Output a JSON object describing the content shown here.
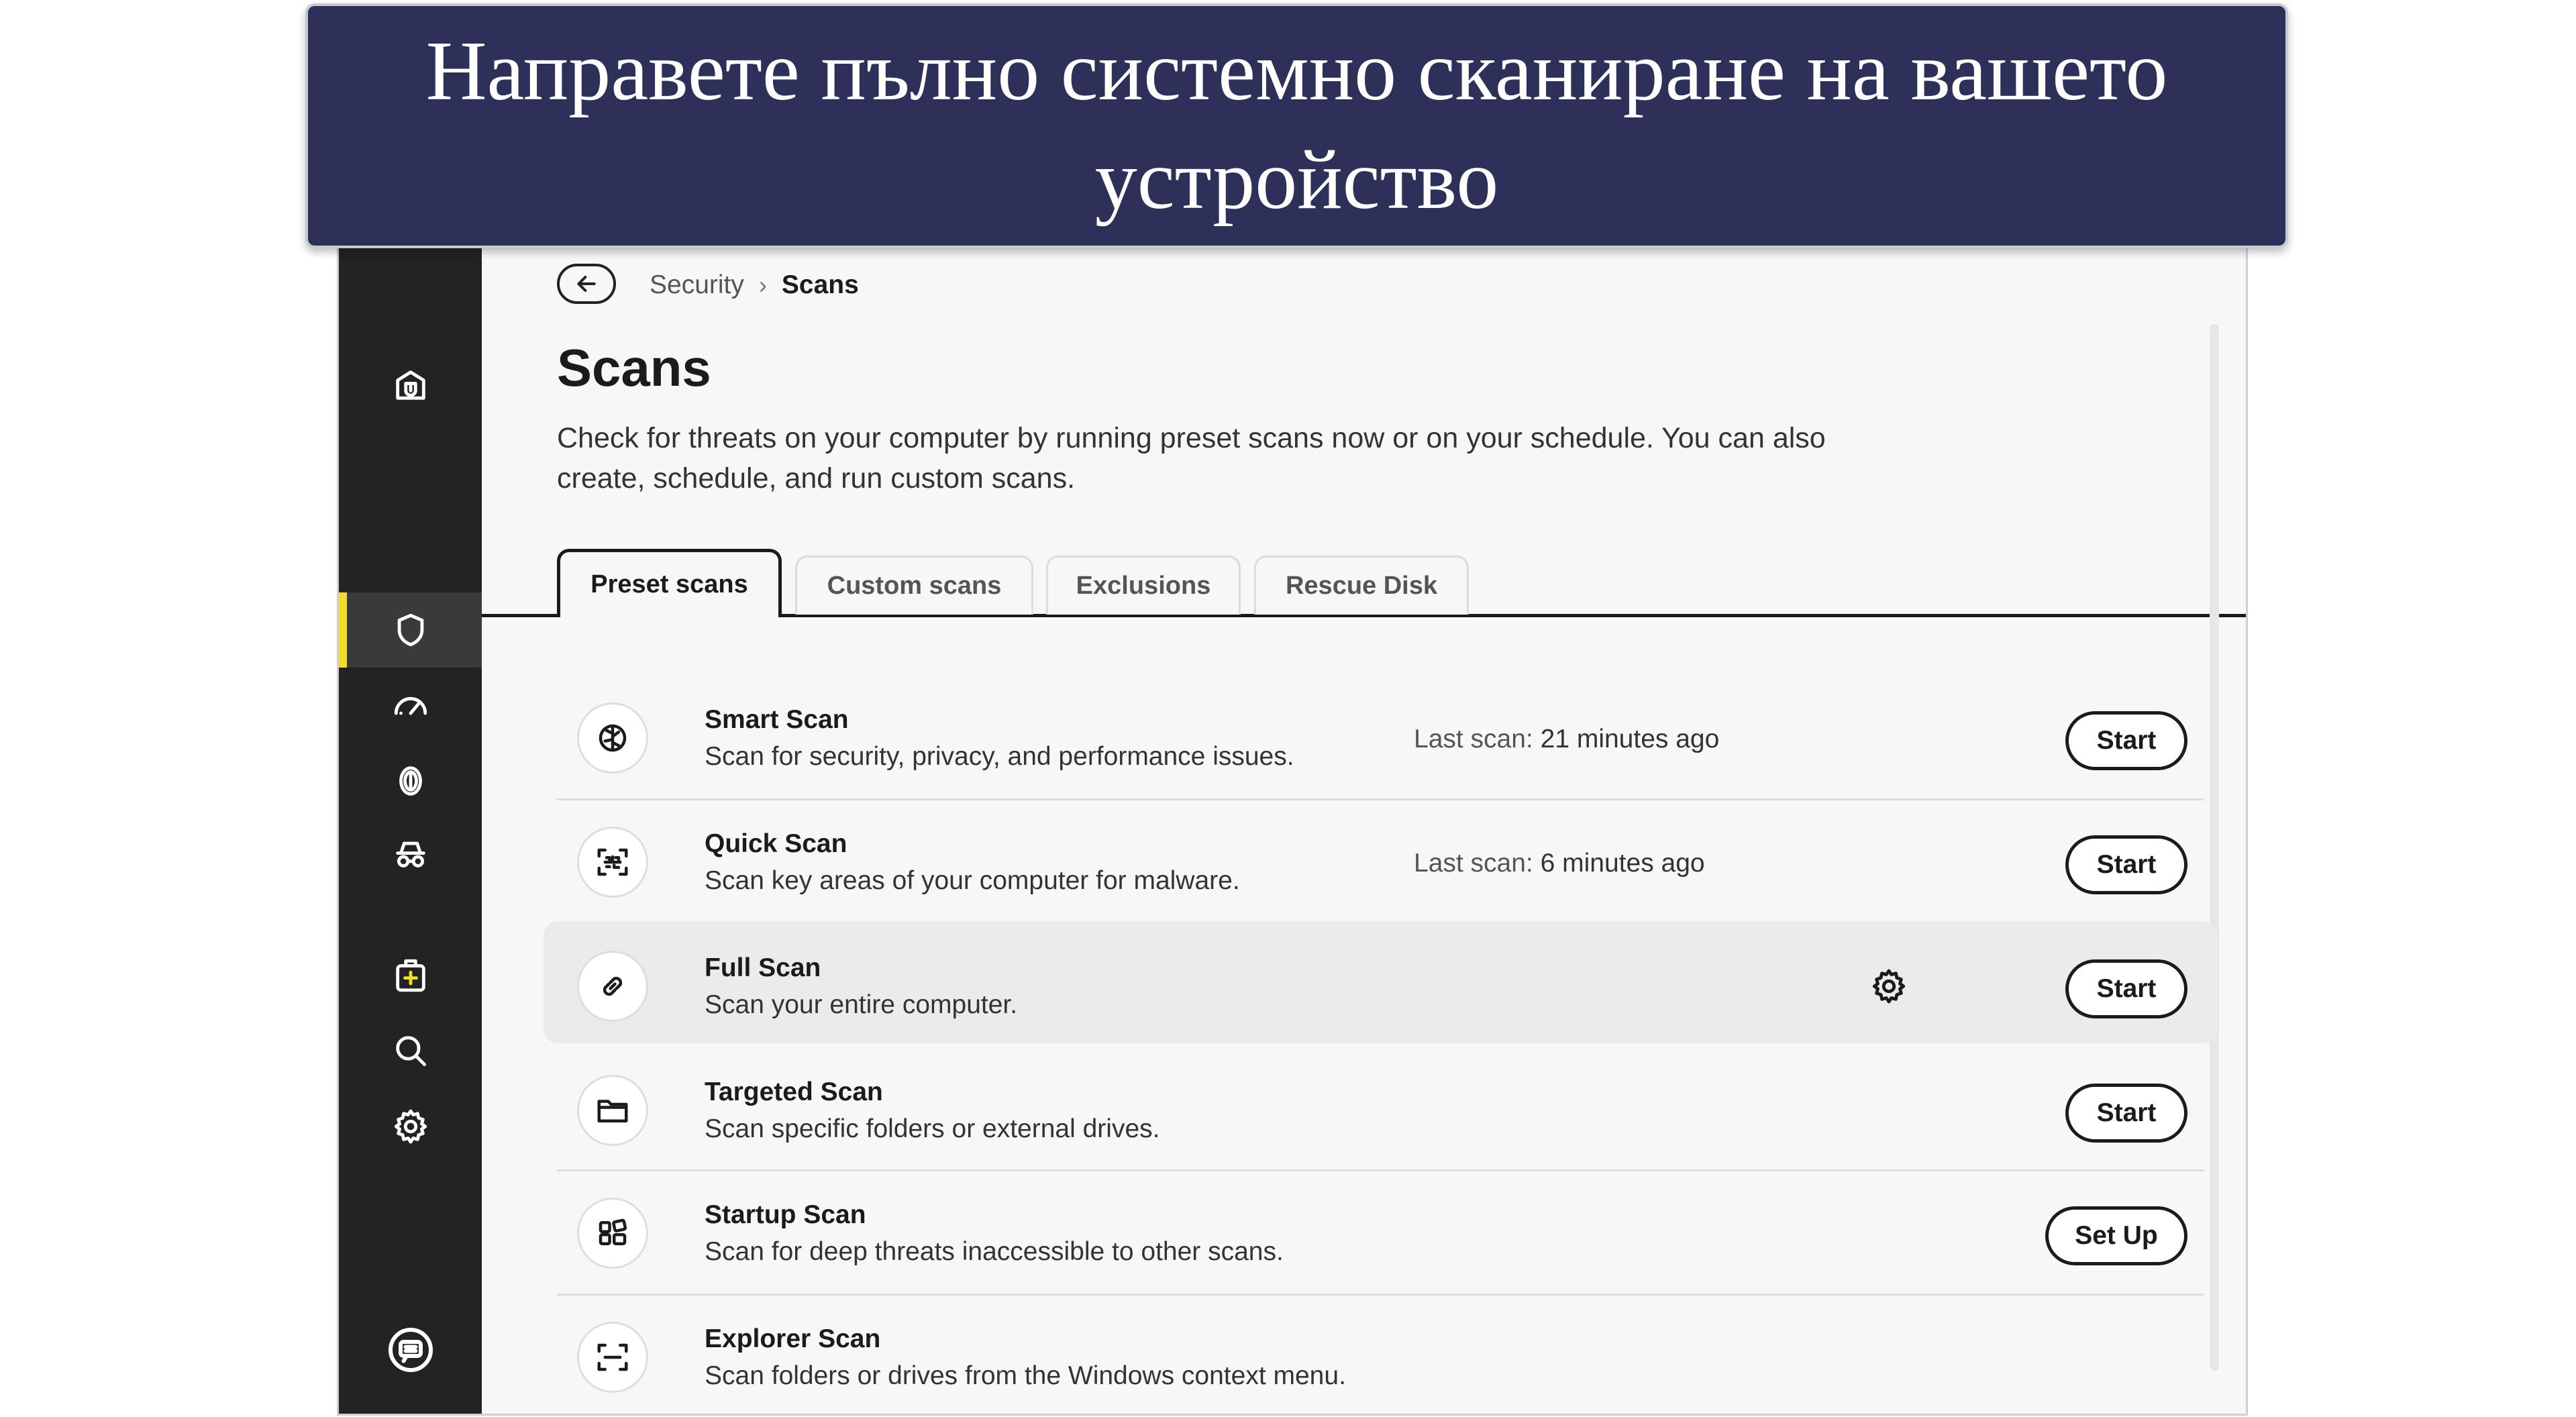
{
  "banner": {
    "text": "Направете пълно системно сканиране на вашето устройство"
  },
  "sidebar": {
    "items": [
      {
        "icon": "home-shield-icon",
        "active": false
      },
      {
        "icon": "shield-icon",
        "active": true
      },
      {
        "icon": "speedometer-icon",
        "active": false
      },
      {
        "icon": "fingerprint-icon",
        "active": false
      },
      {
        "icon": "incognito-icon",
        "active": false
      },
      {
        "icon": "medkit-icon",
        "active": false
      },
      {
        "icon": "search-icon",
        "active": false
      },
      {
        "icon": "gear-icon",
        "active": false
      },
      {
        "icon": "chat-icon",
        "active": false
      }
    ],
    "accent_color": "#f4dc2a"
  },
  "breadcrumb": {
    "parent": "Security",
    "separator": "›",
    "current": "Scans"
  },
  "page": {
    "title": "Scans",
    "description": "Check for threats on your computer by running preset scans now or on your schedule. You can also create, schedule, and run custom scans."
  },
  "tabs": [
    {
      "label": "Preset scans",
      "active": true
    },
    {
      "label": "Custom scans",
      "active": false
    },
    {
      "label": "Exclusions",
      "active": false
    },
    {
      "label": "Rescue Disk",
      "active": false
    }
  ],
  "scans": [
    {
      "icon": "smart-scan-icon",
      "title": "Smart Scan",
      "description": "Scan for security, privacy, and performance issues.",
      "last_label": "Last scan:",
      "last_value": "21 minutes ago",
      "action": "Start"
    },
    {
      "icon": "quick-scan-icon",
      "title": "Quick Scan",
      "description": "Scan key areas of your computer for malware.",
      "last_label": "Last scan:",
      "last_value": "6 minutes ago",
      "action": "Start"
    },
    {
      "icon": "full-scan-icon",
      "title": "Full Scan",
      "description": "Scan your entire computer.",
      "action": "Start",
      "has_settings": true
    },
    {
      "icon": "folder-icon",
      "title": "Targeted Scan",
      "description": "Scan specific folders or external drives.",
      "action": "Start"
    },
    {
      "icon": "windows-icon",
      "title": "Startup Scan",
      "description": "Scan for deep threats inaccessible to other scans.",
      "action": "Set Up"
    },
    {
      "icon": "explorer-scan-icon",
      "title": "Explorer Scan",
      "description": "Scan folders or drives from the Windows context menu."
    }
  ],
  "colors": {
    "banner_bg": "#2d3058",
    "sidebar_bg": "#232323",
    "content_bg": "#f7f7f7"
  }
}
